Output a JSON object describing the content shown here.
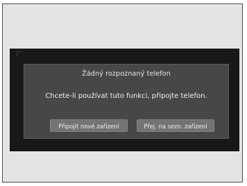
{
  "dialog": {
    "title": "Žádný rozpoznaný telefon",
    "message": "Chcete-li používat tuto funkci, připojte telefon.",
    "buttons": {
      "connect_new_label": "Připojit nové zařízení",
      "go_to_list_label": "Přej. na sezn. zařízení"
    }
  }
}
